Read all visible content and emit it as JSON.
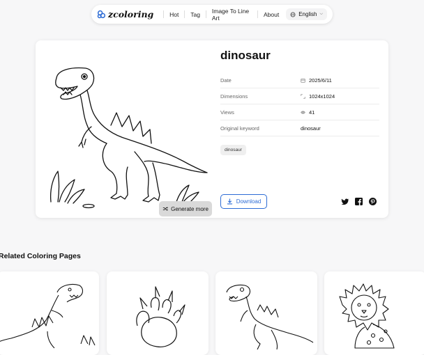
{
  "nav": {
    "logo_text": "zcoloring",
    "links": [
      "Hot",
      "Tag",
      "Image To Line Art",
      "About"
    ],
    "language": "English"
  },
  "detail": {
    "title": "dinosaur",
    "rows": [
      {
        "label": "Date",
        "value": "2025/6/11",
        "icon": "calendar-icon"
      },
      {
        "label": "Dimensions",
        "value": "1024x1024",
        "icon": "dimensions-icon"
      },
      {
        "label": "Views",
        "value": "41",
        "icon": "eye-icon"
      },
      {
        "label": "Original keyword",
        "value": "dinosaur",
        "icon": ""
      }
    ],
    "tag": "dinosaur",
    "download_label": "Download",
    "generate_label": "Generate more"
  },
  "related": {
    "title": "Related Coloring Pages",
    "items": [
      "dinosaur",
      "paw",
      "dinosaur",
      "lion"
    ]
  },
  "colors": {
    "accent": "#2c6bd5"
  }
}
